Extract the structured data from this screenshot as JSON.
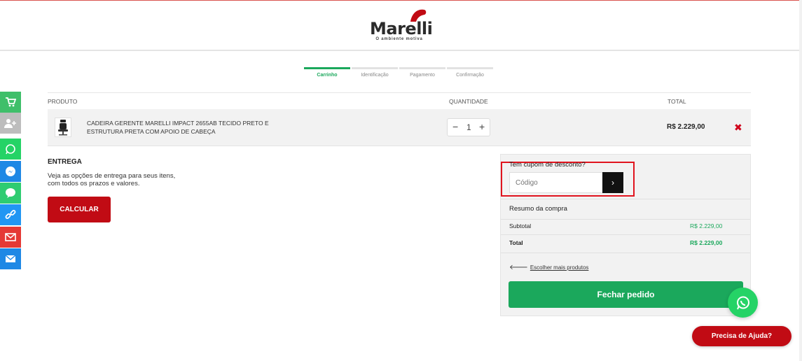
{
  "brand": {
    "name": "Marelli",
    "tagline": "O ambiente motiva"
  },
  "checkout_steps": [
    {
      "label": "Carrinho",
      "active": true
    },
    {
      "label": "Identificação",
      "active": false
    },
    {
      "label": "Pagamento",
      "active": false
    },
    {
      "label": "Confirmação",
      "active": false
    }
  ],
  "cart": {
    "headers": {
      "product": "PRODUTO",
      "quantity": "QUANTIDADE",
      "total": "TOTAL"
    },
    "items": [
      {
        "name": "CADEIRA GERENTE MARELLI IMPACT 2655AB TECIDO PRETO E ESTRUTURA PRETA COM APOIO DE CABEÇA",
        "quantity": "1",
        "total": "R$ 2.229,00",
        "remove_icon": "close-x-icon"
      }
    ]
  },
  "delivery": {
    "title": "ENTREGA",
    "description": "Veja as opções de entrega para seus itens, com todos os prazos e valores.",
    "button_label": "CALCULAR"
  },
  "summary": {
    "coupon_label": "Tem cupom de desconto?",
    "coupon_placeholder": "Código",
    "coupon_submit_icon": "chevron-right-icon",
    "title": "Resumo da compra",
    "subtotal_label": "Subtotal",
    "subtotal_value": "R$ 2.229,00",
    "total_label": "Total",
    "total_value": "R$ 2.229,00",
    "more_products_label": "Escolher mais produtos",
    "checkout_button": "Fechar pedido"
  },
  "side_bar": [
    {
      "icon": "cart-icon",
      "color": "#3fbf6a"
    },
    {
      "icon": "add-user-icon",
      "color": "#bdbdbd"
    },
    {
      "icon": "whatsapp-icon",
      "color": "#25d366"
    },
    {
      "icon": "messenger-icon",
      "color": "#1e88e5"
    },
    {
      "icon": "chat-icon",
      "color": "#2ecc71"
    },
    {
      "icon": "link-icon",
      "color": "#2196f3"
    },
    {
      "icon": "mail-icon",
      "color": "#e53935"
    },
    {
      "icon": "envelope-icon",
      "color": "#1e88e5"
    }
  ],
  "help": {
    "label": "Precisa de Ajuda?",
    "whatsapp_icon": "whatsapp-icon"
  },
  "colors": {
    "brand_red": "#c10b14",
    "green": "#1ba85c",
    "highlight_red": "#e0141e"
  }
}
